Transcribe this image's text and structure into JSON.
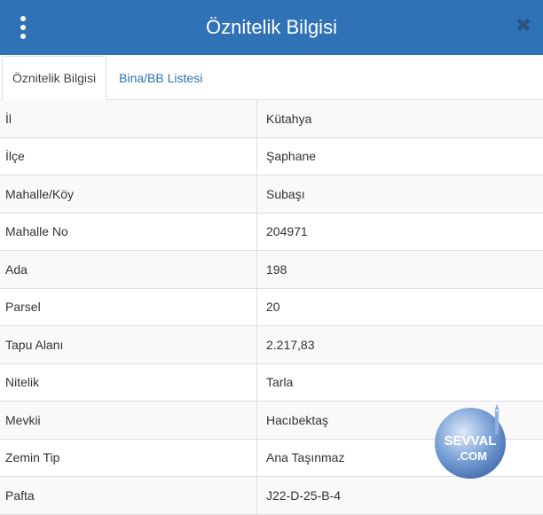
{
  "header": {
    "title": "Öznitelik Bilgisi",
    "menu_icon": "vertical-ellipsis-icon",
    "close_icon": "close-icon"
  },
  "tabs": [
    {
      "label": "Öznitelik Bilgisi",
      "active": true
    },
    {
      "label": "Bina/BB Listesi",
      "active": false
    }
  ],
  "rows": [
    {
      "key": "İl",
      "value": "Kütahya"
    },
    {
      "key": "İlçe",
      "value": "Şaphane"
    },
    {
      "key": "Mahalle/Köy",
      "value": "Subaşı"
    },
    {
      "key": "Mahalle No",
      "value": "204971"
    },
    {
      "key": "Ada",
      "value": "198"
    },
    {
      "key": "Parsel",
      "value": "20"
    },
    {
      "key": "Tapu Alanı",
      "value": "2.217,83"
    },
    {
      "key": "Nitelik",
      "value": "Tarla"
    },
    {
      "key": "Mevkii",
      "value": "Hacıbektaş"
    },
    {
      "key": "Zemin Tip",
      "value": "Ana Taşınmaz"
    },
    {
      "key": "Pafta",
      "value": "J22-D-25-B-4"
    }
  ],
  "watermark": {
    "text_top": "SEVVAL",
    "text_bottom": ".COM"
  },
  "colors": {
    "header_bg": "#2f72b6",
    "tab_link": "#2f72b6",
    "row_alt": "#f9f9f9"
  }
}
